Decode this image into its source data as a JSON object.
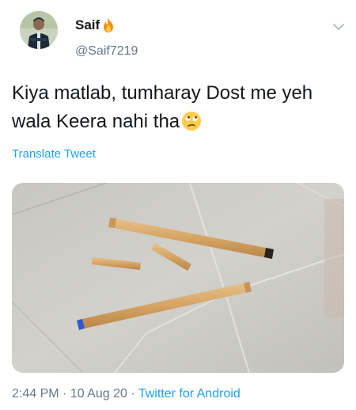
{
  "user": {
    "name": "Saif",
    "handle": "@Saif7219",
    "badge_icon": "fire-icon",
    "avatar_icon": "profile-photo"
  },
  "tweet": {
    "text": "Kiya matlab, tumharay Dost me yeh wala Keera nahi tha",
    "emoji_icon": "face-with-rolling-eyes-icon"
  },
  "actions": {
    "translate_label": "Translate Tweet",
    "menu_icon": "chevron-down-icon"
  },
  "media": {
    "image_icon": "photo-of-broken-pens-on-tile-floor"
  },
  "meta": {
    "time": "2:44 PM",
    "separator": " · ",
    "date": "10 Aug 20",
    "source": "Twitter for Android"
  },
  "colors": {
    "link": "#1da1f2",
    "secondary": "#657786",
    "text": "#14171a"
  }
}
